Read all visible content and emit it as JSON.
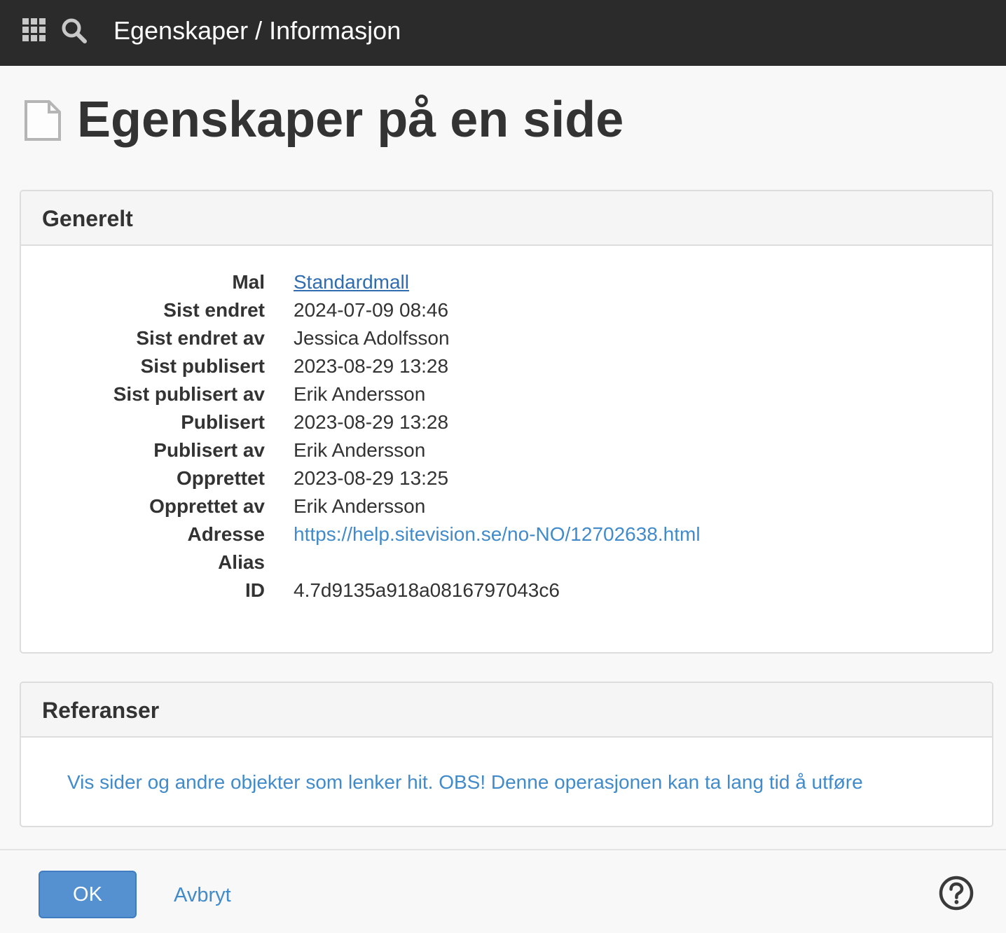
{
  "topbar": {
    "title": "Egenskaper / Informasjon",
    "icons": [
      "apps-grid-icon",
      "search-icon"
    ]
  },
  "page": {
    "title": "Egenskaper på en side",
    "icon": "document-icon"
  },
  "general": {
    "heading": "Generelt",
    "rows": [
      {
        "label": "Mal",
        "value": "Standardmall"
      },
      {
        "label": "Sist endret",
        "value": "2024-07-09 08:46"
      },
      {
        "label": "Sist endret av",
        "value": "Jessica Adolfsson"
      },
      {
        "label": "Sist publisert",
        "value": "2023-08-29 13:28"
      },
      {
        "label": "Sist publisert av",
        "value": "Erik Andersson"
      },
      {
        "label": "Publisert",
        "value": "2023-08-29 13:28"
      },
      {
        "label": "Publisert av",
        "value": "Erik Andersson"
      },
      {
        "label": "Opprettet",
        "value": "2023-08-29 13:25"
      },
      {
        "label": "Opprettet av",
        "value": "Erik Andersson"
      },
      {
        "label": "Adresse",
        "value": "https://help.sitevision.se/no-NO/12702638.html"
      },
      {
        "label": "Alias",
        "value": ""
      },
      {
        "label": "ID",
        "value": "4.7d9135a918a0816797043c6"
      }
    ]
  },
  "references": {
    "heading": "Referanser",
    "link": "Vis sider og andre objekter som lenker hit. OBS! Denne operasjonen kan ta lang tid å utføre"
  },
  "footer": {
    "ok_label": "OK",
    "cancel_label": "Avbryt",
    "help_icon": "help-icon"
  },
  "colors": {
    "topbar": "#2b2b2b",
    "link": "#428bca",
    "primary_button": "#5591d0"
  }
}
